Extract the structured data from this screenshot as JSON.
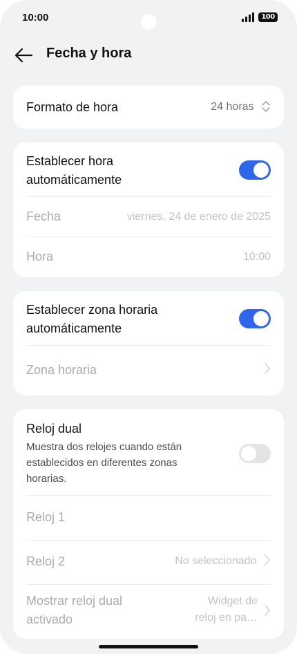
{
  "status_bar": {
    "time": "10:00",
    "battery": "100"
  },
  "header": {
    "title": "Fecha y hora"
  },
  "time_format": {
    "label": "Formato de hora",
    "value": "24 horas"
  },
  "auto_time": {
    "label_line1": "Establecer hora",
    "label_line2": "automáticamente",
    "enabled": true,
    "date_label": "Fecha",
    "date_value": "viernes, 24 de enero de 2025",
    "time_label": "Hora",
    "time_value": "10:00"
  },
  "auto_timezone": {
    "label_line1": "Establecer zona horaria",
    "label_line2": "automáticamente",
    "enabled": true,
    "timezone_label": "Zona horaria"
  },
  "dual_clock": {
    "label": "Reloj dual",
    "desc_line1": "Muestra dos relojes cuando están",
    "desc_line2": "establecidos en diferentes zonas",
    "desc_line3": "horarias.",
    "enabled": false,
    "clock1_label": "Reloj 1",
    "clock2_label": "Reloj 2",
    "clock2_value": "No seleccionado",
    "show_label_line1": "Mostrar reloj dual",
    "show_label_line2": "activado",
    "show_value_line1": "Widget de",
    "show_value_line2": "reloj en pa…"
  },
  "colors": {
    "accent": "#2f66ea",
    "background": "#f1f2f4",
    "card": "#ffffff"
  },
  "icons": {
    "back": "arrow-left-icon",
    "select": "up-down-chevron-icon",
    "forward": "chevron-right-icon"
  }
}
